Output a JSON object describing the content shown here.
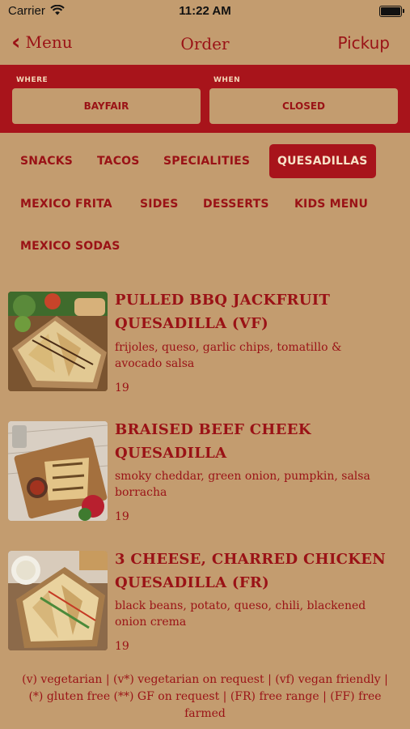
{
  "status": {
    "carrier": "Carrier",
    "time": "11:22 AM"
  },
  "nav": {
    "back_label": "Menu",
    "title": "Order",
    "right_label": "Pickup"
  },
  "selector": {
    "where_caption": "WHERE",
    "where_value": "BAYFAIR",
    "when_caption": "WHEN",
    "when_value": "CLOSED"
  },
  "tabs": [
    {
      "label": "SNACKS"
    },
    {
      "label": "TACOS"
    },
    {
      "label": "SPECIALITIES"
    },
    {
      "label": "QUESADILLAS",
      "active": true
    },
    {
      "label": "MEXICO FRITA"
    },
    {
      "label": "SIDES"
    },
    {
      "label": "DESSERTS"
    },
    {
      "label": "KIDS MENU"
    },
    {
      "label": "MEXICO SODAS"
    }
  ],
  "items": [
    {
      "name_line1": "PULLED BBQ JACKFRUIT",
      "name_line2": "QUESADILLA (VF)",
      "desc_line1": "frijoles, queso, garlic chips, tomatillo &",
      "desc_line2": "avocado salsa",
      "price": "19"
    },
    {
      "name_line1": "BRAISED BEEF CHEEK",
      "name_line2": "QUESADILLA",
      "desc_line1": "smoky cheddar, green onion, pumpkin, salsa",
      "desc_line2": "borracha",
      "price": "19"
    },
    {
      "name_line1": "3 CHEESE, CHARRED CHICKEN",
      "name_line2": "QUESADILLA (FR)",
      "desc_line1": "black beans, potato, queso, chili, blackened",
      "desc_line2": "onion crema",
      "price": "19"
    }
  ],
  "footer": {
    "line1": "(v) vegetarian | (v*) vegetarian on request | (vf) vegan friendly |",
    "line2": "(*) gluten free (**) GF on request | (FR) free range | (FF) free",
    "line3": "farmed"
  },
  "colors": {
    "brand_red": "#a8141b",
    "background": "#c39c6f",
    "text_red": "#9a1216"
  }
}
